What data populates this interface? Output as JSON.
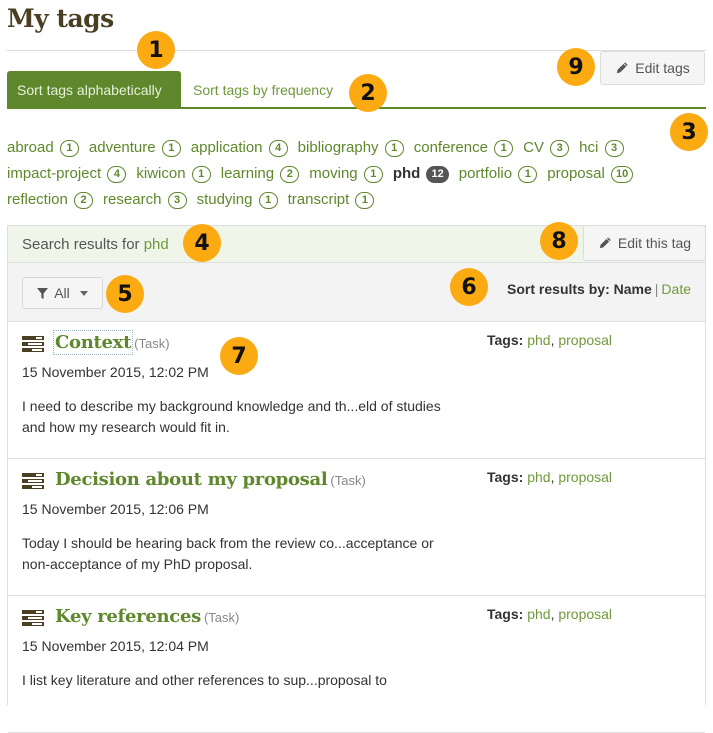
{
  "page": {
    "title": "My tags"
  },
  "tabs": [
    {
      "label": "Sort tags alphabetically",
      "active": true
    },
    {
      "label": "Sort tags by frequency",
      "active": false
    }
  ],
  "edit_tags_button": {
    "label": "Edit tags",
    "icon": "pencil-icon"
  },
  "tags": [
    {
      "name": "abroad",
      "count": "1"
    },
    {
      "name": "adventure",
      "count": "1"
    },
    {
      "name": "application",
      "count": "4"
    },
    {
      "name": "bibliography",
      "count": "1"
    },
    {
      "name": "conference",
      "count": "1"
    },
    {
      "name": "CV",
      "count": "3"
    },
    {
      "name": "hci",
      "count": "3"
    },
    {
      "name": "impact-project",
      "count": "4"
    },
    {
      "name": "kiwicon",
      "count": "1"
    },
    {
      "name": "learning",
      "count": "2"
    },
    {
      "name": "moving",
      "count": "1"
    },
    {
      "name": "phd",
      "count": "12",
      "selected": true
    },
    {
      "name": "portfolio",
      "count": "1"
    },
    {
      "name": "proposal",
      "count": "10"
    },
    {
      "name": "reflection",
      "count": "2"
    },
    {
      "name": "research",
      "count": "3"
    },
    {
      "name": "studying",
      "count": "1"
    },
    {
      "name": "transcript",
      "count": "1"
    }
  ],
  "results": {
    "heading_prefix": "Search results for ",
    "search_term": "phd",
    "edit_tag_button": {
      "label": "Edit this tag",
      "icon": "pencil-icon"
    },
    "filter": {
      "label": "All",
      "icon": "filter-icon"
    },
    "sort": {
      "label": "Sort results by:",
      "options": [
        "Name",
        "Date"
      ],
      "separator": "|",
      "selected": "Name"
    },
    "items": [
      {
        "title": "Context",
        "type": "(Task)",
        "date": "15 November 2015, 12:02 PM",
        "description": "I need to describe my background knowledge and th...eld of studies and how my research would fit in.",
        "tags_label": "Tags:",
        "tags": [
          "phd",
          "proposal"
        ],
        "icon": "plan-icon"
      },
      {
        "title": "Decision about my proposal",
        "type": "(Task)",
        "date": "15 November 2015, 12:06 PM",
        "description": "Today I should be hearing back from the review co...acceptance or non-acceptance of my PhD proposal.",
        "tags_label": "Tags:",
        "tags": [
          "phd",
          "proposal"
        ],
        "icon": "plan-icon"
      },
      {
        "title": "Key references",
        "type": "(Task)",
        "date": "15 November 2015, 12:04 PM",
        "description": "I list key literature and other references to sup...proposal to",
        "tags_label": "Tags:",
        "tags": [
          "phd",
          "proposal"
        ],
        "icon": "plan-icon"
      }
    ]
  },
  "callouts": [
    "1",
    "2",
    "3",
    "4",
    "5",
    "6",
    "7",
    "8",
    "9"
  ],
  "colors": {
    "brand_green": "#5e882b",
    "link_green": "#6f9a3b",
    "callout": "#fbaa12",
    "title_brown": "#4b3f23"
  }
}
